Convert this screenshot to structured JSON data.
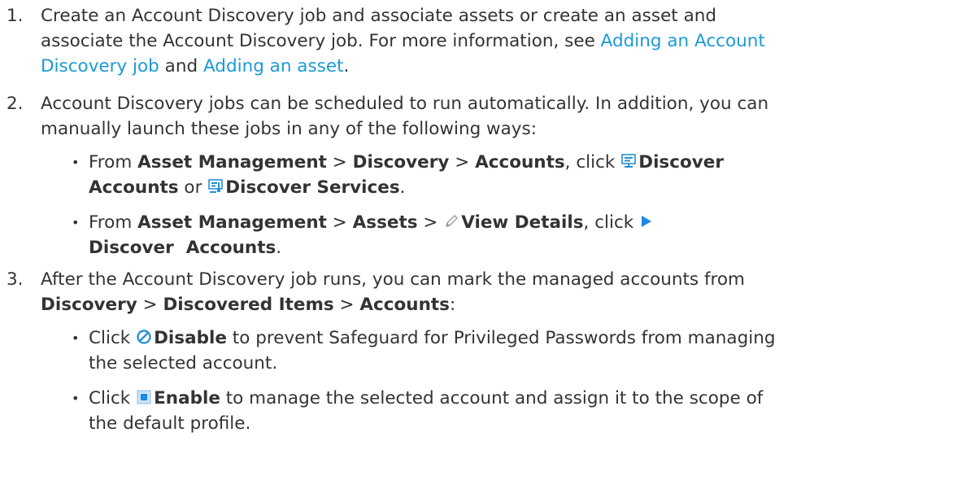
{
  "colors": {
    "text": "#333333",
    "link": "#1a9ad6",
    "icon_blue": "#2a8fd6"
  },
  "icons": [
    "monitor-icon",
    "services-icon",
    "pencil-icon",
    "play-icon",
    "disable-icon",
    "enable-icon"
  ],
  "step1": {
    "number": "1.",
    "line1": "Create an Account Discovery job and associate assets or create an asset and",
    "line2_a": "associate the Account Discovery job. For more information, see ",
    "link1_line1": "Adding an Account",
    "link1_line2": "Discovery job",
    "line3_and": " and ",
    "link2": "Adding an asset",
    "line3_end": "."
  },
  "step2": {
    "number": "2.",
    "line1": "Account Discovery jobs can be scheduled to run automatically. In addition, you can",
    "line2": "manually launch these jobs in any of the following ways:",
    "bullet1": {
      "from": "From ",
      "asset_management": "Asset Management",
      "sep1": " > ",
      "discovery": "Discovery",
      "sep2": " > ",
      "accounts": "Accounts",
      "click": ", click ",
      "discover_accounts_a": "Discover",
      "discover_accounts_b": "Accounts",
      "or": " or ",
      "discover_services": "Discover Services",
      "end": "."
    },
    "bullet2": {
      "from": "From ",
      "asset_management": "Asset Management",
      "sep1": " > ",
      "assets": "Assets",
      "sep2": " > ",
      "view_details": "View Details",
      "click": ", click ",
      "discover_accounts": "Discover  Accounts",
      "end": "."
    }
  },
  "step3": {
    "number": "3.",
    "line1": "After the Account Discovery job runs, you can mark the managed accounts from",
    "discovery": "Discovery",
    "sep1": " > ",
    "discovered_items": "Discovered Items",
    "sep2": " > ",
    "accounts": "Accounts",
    "colon": ":",
    "bullet1": {
      "click": "Click ",
      "disable": "Disable",
      "rest1": " to prevent Safeguard for Privileged Passwords from managing",
      "rest2": "the selected account."
    },
    "bullet2": {
      "click": "Click ",
      "enable": "Enable",
      "rest1": " to manage the selected account and assign it to the scope of",
      "rest2": "the default profile."
    }
  },
  "bullet_char": "•"
}
